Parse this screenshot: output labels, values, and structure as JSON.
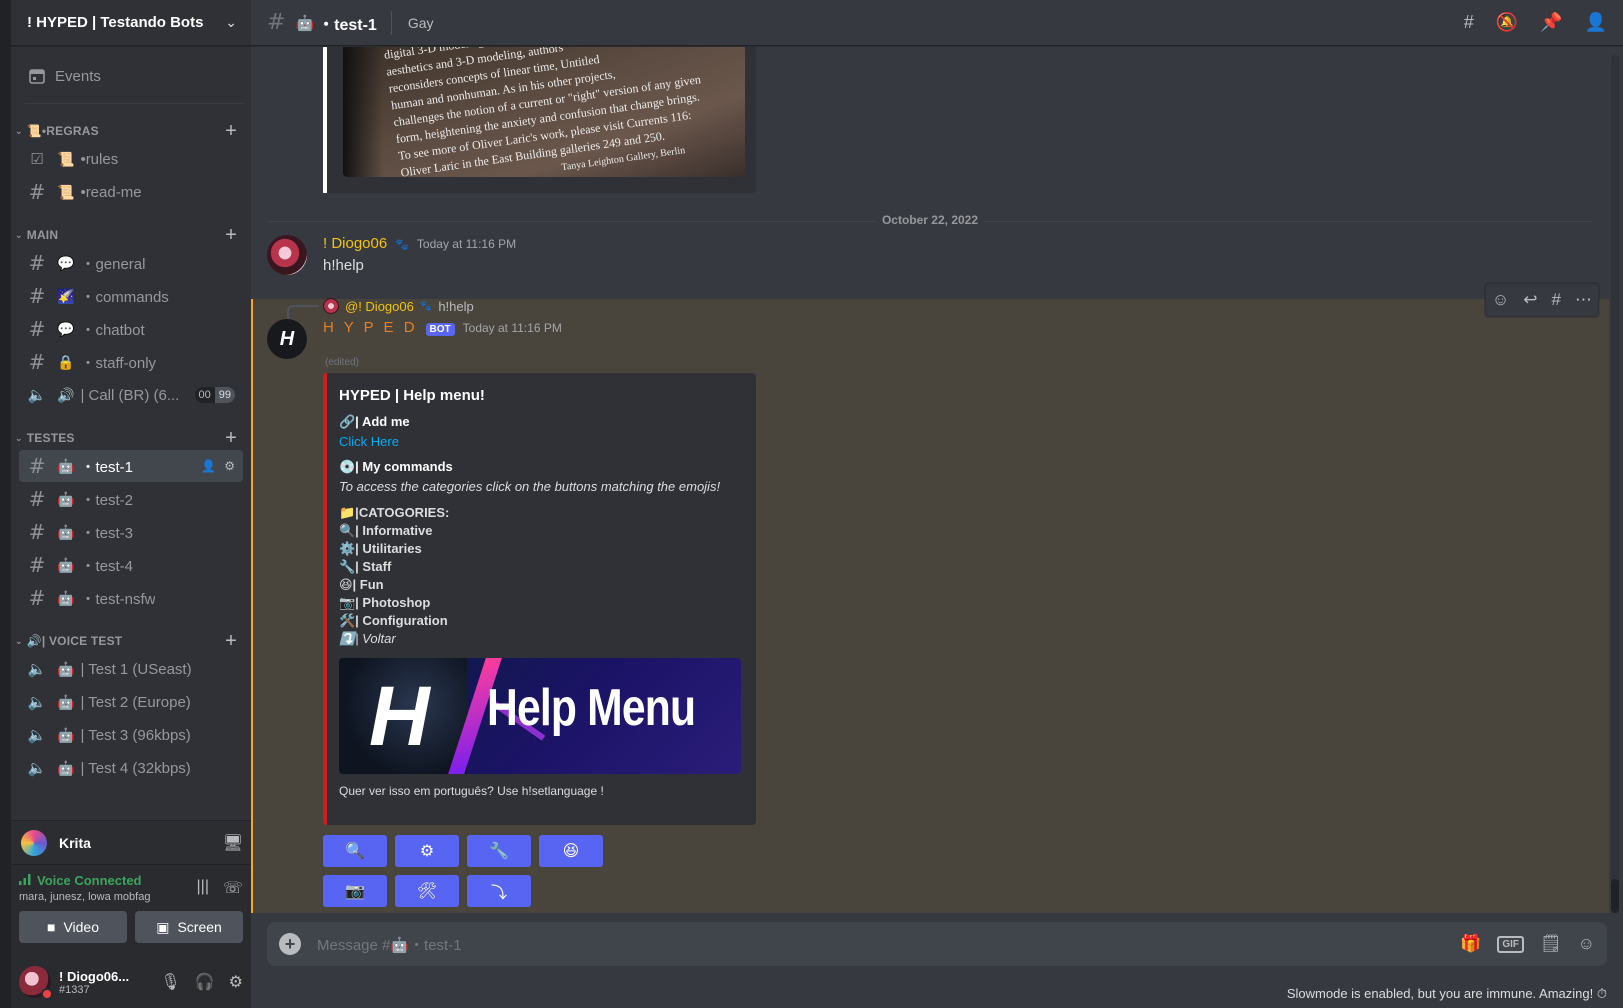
{
  "server": {
    "name": "! HYPED | Testando Bots"
  },
  "sidebar": {
    "events_label": "Events",
    "categories": [
      {
        "name": "📜•REGRAS",
        "channels": [
          {
            "icon": "☑",
            "emoji": "📜",
            "label": "•rules"
          },
          {
            "icon": "#",
            "emoji": "📜",
            "label": "•read-me"
          }
        ]
      },
      {
        "name": "MAIN",
        "channels": [
          {
            "icon": "#",
            "emoji": "💬",
            "label": "・general"
          },
          {
            "icon": "#",
            "emoji": "🌠",
            "label": "・commands"
          },
          {
            "icon": "#",
            "emoji": "💬",
            "label": "・chatbot"
          },
          {
            "icon": "#",
            "emoji": "🔒",
            "label": "・staff-only"
          },
          {
            "icon": "🔈",
            "emoji": "🔊",
            "label": "| Call (BR) (6...",
            "counter": [
              "00",
              "99"
            ]
          }
        ]
      },
      {
        "name": "TESTES",
        "channels": [
          {
            "icon": "#",
            "emoji": "🤖",
            "label": "・test-1",
            "active": true
          },
          {
            "icon": "#",
            "emoji": "🤖",
            "label": "・test-2"
          },
          {
            "icon": "#",
            "emoji": "🤖",
            "label": "・test-3"
          },
          {
            "icon": "#",
            "emoji": "🤖",
            "label": "・test-4"
          },
          {
            "icon": "#",
            "emoji": "🤖",
            "label": "・test-nsfw"
          }
        ]
      },
      {
        "name": "🔊| VOICE TEST",
        "channels": [
          {
            "icon": "🔈",
            "emoji": "🤖",
            "label": "| Test 1 (USeast)"
          },
          {
            "icon": "🔈",
            "emoji": "🤖",
            "label": "| Test 2 (Europe)"
          },
          {
            "icon": "🔈",
            "emoji": "🤖",
            "label": "| Test 3 (96kbps)"
          },
          {
            "icon": "🔈",
            "emoji": "🤖",
            "label": "| Test 4 (32kbps)"
          }
        ]
      }
    ],
    "activity_user": "Krita",
    "voice": {
      "status": "Voice Connected",
      "members": "mara, junesz, lowa mobfag",
      "video_label": "Video",
      "screen_label": "Screen"
    },
    "user": {
      "name": "! Diogo06...",
      "tag": "#1337"
    }
  },
  "header": {
    "channel_emoji": "🤖",
    "channel_name": "・test-1",
    "topic": "Gay"
  },
  "previous_image_text": [
    "digital 3-D modeling",
    "aesthetics and 3-D modeling, authors",
    "reconsiders concepts of linear time, Untitled",
    "human and nonhuman. As in his other projects,",
    "challenges the notion of a current or \"right\" version of any given",
    "form, heightening the anxiety and confusion that change brings.",
    "To see more of Oliver Laric's work, please visit Currents 116:",
    "Oliver Laric in the East Building galleries 249 and 250.",
    "",
    "Tanya Leighton Gallery, Berlin"
  ],
  "date_divider": "October 22, 2022",
  "message1": {
    "author": "! Diogo06",
    "timestamp": "Today at 11:16 PM",
    "content": "h!help"
  },
  "message2": {
    "reply_author": "@! Diogo06",
    "reply_text": "h!help",
    "author": "H Y P E D",
    "bot_badge": "BOT",
    "timestamp": "Today at 11:16 PM",
    "edited": "(edited)",
    "avatar_letter": "H",
    "embed": {
      "title": "HYPED | Help menu!",
      "field1_name": "🔗| Add me",
      "field1_link": "Click Here",
      "field2_name": "💿| My commands",
      "field2_value": "To access the categories click on the buttons matching the emojis!",
      "categories_header": "📁|CATOGORIES:",
      "categories": [
        {
          "text": "🔍| Informative",
          "italic": false
        },
        {
          "text": "⚙️| Utilitaries",
          "italic": false
        },
        {
          "text": "🔧| Staff",
          "italic": false
        },
        {
          "text": "😆| Fun",
          "italic": false
        },
        {
          "text": "📷| Photoshop",
          "italic": false
        },
        {
          "text": "🛠️| Configuration",
          "italic": false
        },
        {
          "text": "⤵️| Voltar",
          "italic": true
        }
      ],
      "image_left_letter": "H",
      "image_title": "Help Menu",
      "footer": "Quer ver isso em português? Use h!setlanguage !"
    },
    "buttons_row1": [
      "🔍",
      "⚙",
      "🔧",
      "😆"
    ],
    "buttons_row2": [
      "📷",
      "🛠",
      "⤵"
    ]
  },
  "composer": {
    "placeholder": "Message #🤖・test-1"
  },
  "slowmode_text": "Slowmode is enabled, but you are immune. Amazing! ⏱",
  "colors": {
    "accent": "#5865f2",
    "embed_border": "#d21b1b",
    "highlight_bg": "#49443c",
    "voice_green": "#3ba55d"
  }
}
